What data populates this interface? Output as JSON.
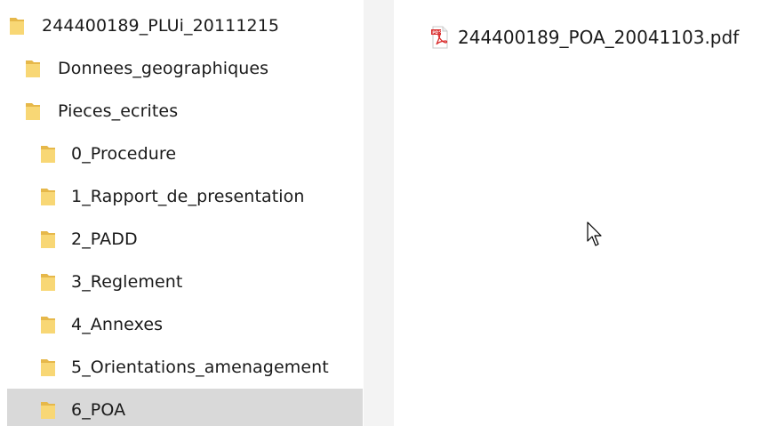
{
  "nav_tree": {
    "items": [
      {
        "label": "244400189_PLUi_20111215"
      },
      {
        "label": "Donnees_geographiques"
      },
      {
        "label": "Pieces_ecrites"
      },
      {
        "label": "0_Procedure"
      },
      {
        "label": "1_Rapport_de_presentation"
      },
      {
        "label": "2_PADD"
      },
      {
        "label": "3_Reglement"
      },
      {
        "label": "4_Annexes"
      },
      {
        "label": "5_Orientations_amenagement"
      },
      {
        "label": "6_POA",
        "selected": true
      }
    ]
  },
  "content": {
    "files": [
      {
        "name": "244400189_POA_20041103.pdf",
        "icon": "pdf-file-icon"
      }
    ]
  },
  "colors": {
    "folder_yellow": "#f8d775",
    "folder_dark": "#e6b84a",
    "selected_bg": "#d9d9d9",
    "splitter_bg": "#f3f3f3",
    "pdf_red": "#d92b2b"
  }
}
